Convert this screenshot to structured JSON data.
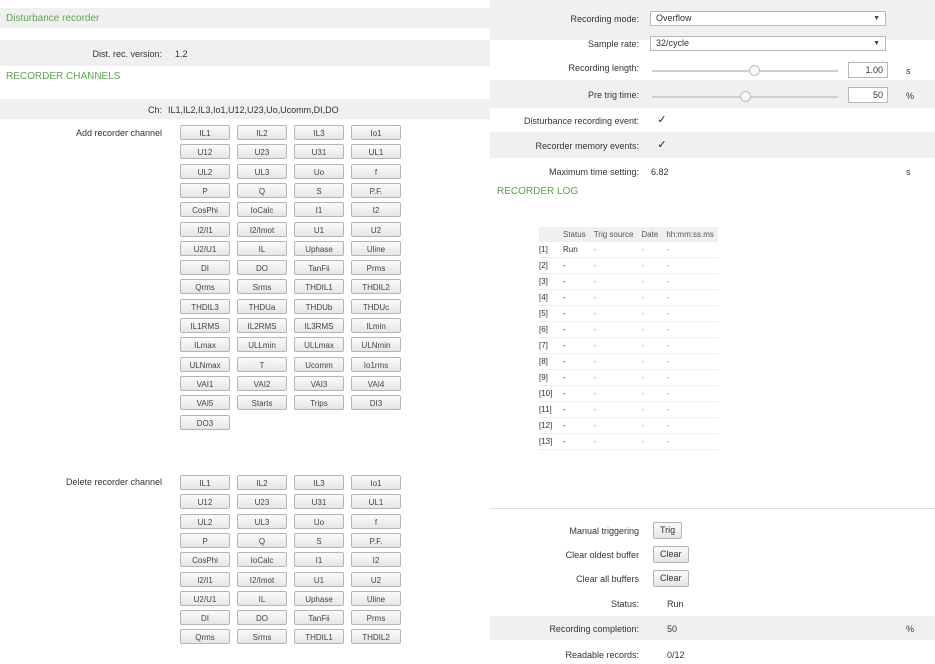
{
  "left": {
    "section_title": "Disturbance recorder",
    "version_label": "Dist. rec. version:",
    "version_value": "1.2",
    "channels_title": "RECORDER CHANNELS",
    "ch_label": "Ch:",
    "ch_value": "IL1,IL2,IL3,Io1,U12,U23,Uo,Ucomm,DI,DO",
    "add_label": "Add recorder channel",
    "delete_label": "Delete recorder channel",
    "add_buttons": [
      "IL1",
      "IL2",
      "IL3",
      "Io1",
      "U12",
      "U23",
      "U31",
      "UL1",
      "UL2",
      "UL3",
      "Uo",
      "f",
      "P",
      "Q",
      "S",
      "P.F.",
      "CosPhi",
      "IoCalc",
      "I1",
      "I2",
      "I2/I1",
      "I2/Imot",
      "U1",
      "U2",
      "U2/U1",
      "IL",
      "Uphase",
      "Uline",
      "DI",
      "DO",
      "TanFii",
      "Prms",
      "Qrms",
      "Srms",
      "THDIL1",
      "THDIL2",
      "THDIL3",
      "THDUa",
      "THDUb",
      "THDUc",
      "IL1RMS",
      "IL2RMS",
      "IL3RMS",
      "ILmin",
      "ILmax",
      "ULLmin",
      "ULLmax",
      "ULNmin",
      "ULNmax",
      "T",
      "Ucomm",
      "Io1rms",
      "VAI1",
      "VAI2",
      "VAI3",
      "VAI4",
      "VAI5",
      "Starts",
      "Trips",
      "DI3",
      "DO3"
    ],
    "delete_buttons": [
      "IL1",
      "IL2",
      "IL3",
      "Io1",
      "U12",
      "U23",
      "U31",
      "UL1",
      "UL2",
      "UL3",
      "Uo",
      "f",
      "P",
      "Q",
      "S",
      "P.F.",
      "CosPhi",
      "IoCalc",
      "I1",
      "I2",
      "I2/I1",
      "I2/Imot",
      "U1",
      "U2",
      "U2/U1",
      "IL",
      "Uphase",
      "Uline",
      "DI",
      "DO",
      "TanFii",
      "Prms",
      "Qrms",
      "Srms",
      "THDIL1",
      "THDIL2"
    ]
  },
  "settings": {
    "mode_label": "Recording mode:",
    "mode_value": "Overflow",
    "rate_label": "Sample rate:",
    "rate_value": "32/cycle",
    "length_label": "Recording length:",
    "length_value": "1.00",
    "length_unit": "s",
    "length_level": 0.55,
    "pretrig_label": "Pre trig time:",
    "pretrig_value": "50",
    "pretrig_unit": "%",
    "pretrig_level": 0.5,
    "event_label": "Disturbance recording event:",
    "event_checked": "✓",
    "memory_label": "Recorder memory events:",
    "memory_checked": "✓",
    "maxtime_label": "Maximum time setting:",
    "maxtime_value": "6.82",
    "maxtime_unit": "s"
  },
  "log": {
    "title": "RECORDER LOG",
    "headers": [
      "Status",
      "Trig source",
      "Date",
      "hh:mm:ss.ms"
    ],
    "rows": [
      {
        "idx": "[1]",
        "status": "Run",
        "trig": "-",
        "date": "-",
        "time": "-"
      },
      {
        "idx": "[2]",
        "status": "-",
        "trig": "-",
        "date": "-",
        "time": "-"
      },
      {
        "idx": "[3]",
        "status": "-",
        "trig": "-",
        "date": "-",
        "time": "-"
      },
      {
        "idx": "[4]",
        "status": "-",
        "trig": "-",
        "date": "-",
        "time": "-"
      },
      {
        "idx": "[5]",
        "status": "-",
        "trig": "-",
        "date": "-",
        "time": "-"
      },
      {
        "idx": "[6]",
        "status": "-",
        "trig": "-",
        "date": "-",
        "time": "-"
      },
      {
        "idx": "[7]",
        "status": "-",
        "trig": "-",
        "date": "-",
        "time": "-"
      },
      {
        "idx": "[8]",
        "status": "-",
        "trig": "-",
        "date": "-",
        "time": "-"
      },
      {
        "idx": "[9]",
        "status": "-",
        "trig": "-",
        "date": "-",
        "time": "-"
      },
      {
        "idx": "[10]",
        "status": "-",
        "trig": "-",
        "date": "-",
        "time": "-"
      },
      {
        "idx": "[11]",
        "status": "-",
        "trig": "-",
        "date": "-",
        "time": "-"
      },
      {
        "idx": "[12]",
        "status": "-",
        "trig": "-",
        "date": "-",
        "time": "-"
      },
      {
        "idx": "[13]",
        "status": "-",
        "trig": "-",
        "date": "-",
        "time": "-"
      }
    ]
  },
  "controls": {
    "manual_label": "Manual triggering",
    "manual_button": "Trig",
    "clear_oldest_label": "Clear oldest buffer",
    "clear_oldest_button": "Clear",
    "clear_all_label": "Clear all buffers",
    "clear_all_button": "Clear",
    "status_label": "Status:",
    "status_value": "Run",
    "completion_label": "Recording completion:",
    "completion_value": "50",
    "completion_unit": "%",
    "readable_label": "Readable records:",
    "readable_value": "0/12"
  }
}
